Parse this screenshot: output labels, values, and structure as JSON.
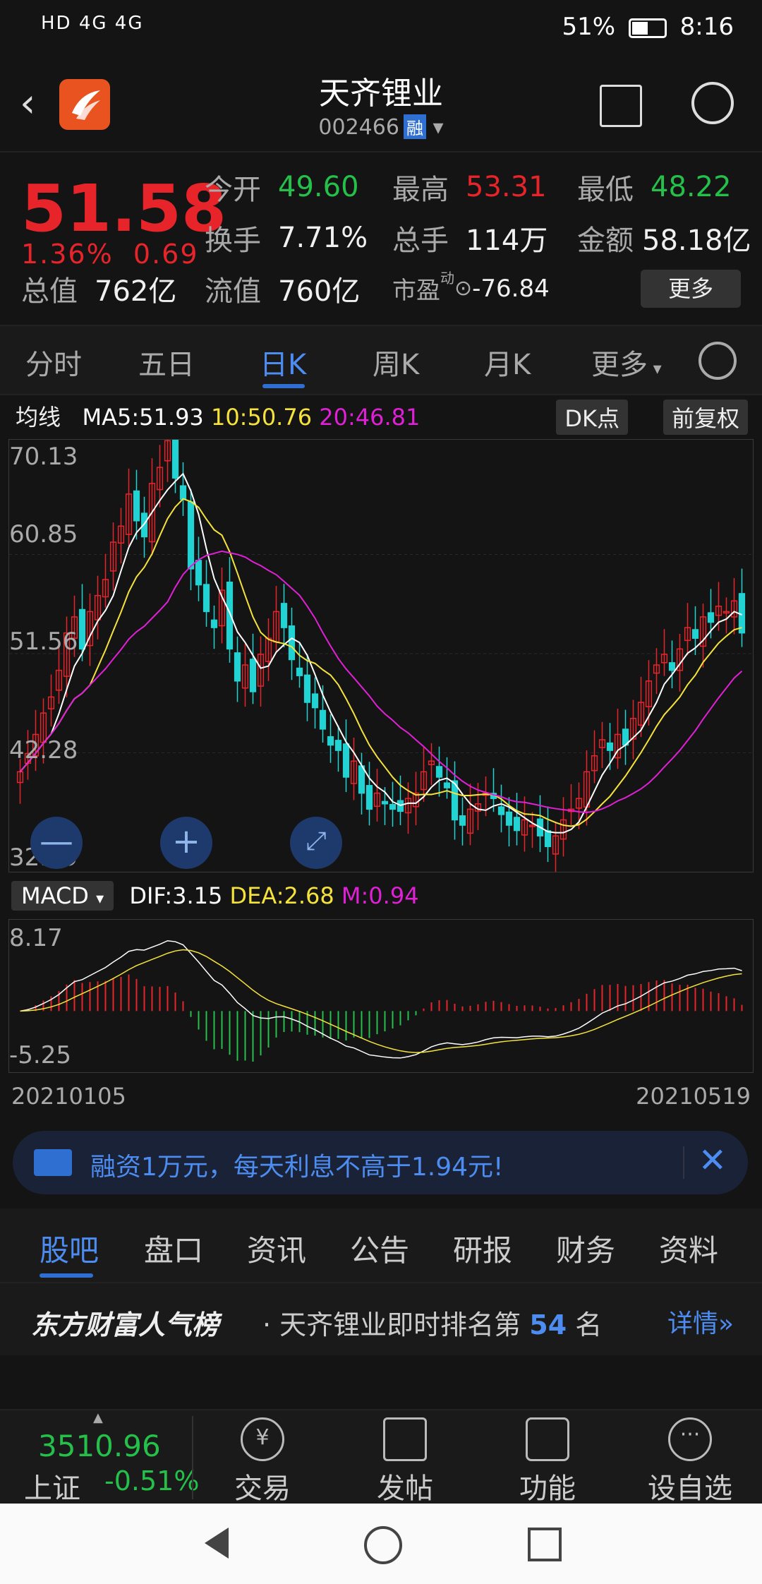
{
  "status": {
    "carrier": "HD 4G 4G",
    "battery_pct": "51%",
    "time": "8:16",
    "battery_level": 0.51
  },
  "header": {
    "title": "天齐锂业",
    "code": "002466",
    "rong_badge": "融"
  },
  "quote": {
    "price": "51.58",
    "change_pct": "1.36%",
    "change_abs": "0.69",
    "open_label": "今开",
    "open": "49.60",
    "high_label": "最高",
    "high": "53.31",
    "low_label": "最低",
    "low": "48.22",
    "turnover_label": "换手",
    "turnover": "7.71%",
    "volume_label": "总手",
    "volume": "114万",
    "amount_label": "金额",
    "amount": "58.18亿",
    "mktcap_label": "总值",
    "mktcap": "762亿",
    "float_label": "流值",
    "float": "760亿",
    "pe_label": "市盈",
    "pe_sup": "动",
    "pe": "-76.84",
    "more_label": "更多"
  },
  "ktabs": {
    "items": [
      "分时",
      "五日",
      "日K",
      "周K",
      "月K",
      "更多"
    ],
    "active": "日K"
  },
  "ma": {
    "label": "均线",
    "ma5": "MA5:51.93",
    "ma10": "10:50.76",
    "ma20": "20:46.81",
    "dk_button": "DK点",
    "fq_button": "前复权"
  },
  "macd": {
    "selector": "MACD",
    "dif": "DIF:3.15",
    "dea": "DEA:2.68",
    "m": "M:0.94"
  },
  "kchart_yaxis": [
    "70.13",
    "60.85",
    "51.56",
    "42.28",
    "32.99"
  ],
  "macd_yaxis": [
    "8.17",
    "-5.25"
  ],
  "dates": {
    "start": "20210105",
    "end": "20210519"
  },
  "chart_controls": {
    "zoom_out": "—",
    "zoom_in": "+"
  },
  "banner": {
    "text": "融资1万元，每天利息不高于1.94元!"
  },
  "sections": {
    "items": [
      "股吧",
      "盘口",
      "资讯",
      "公告",
      "研报",
      "财务",
      "资料"
    ],
    "active": "股吧"
  },
  "rank": {
    "brand": "东方财富人气榜",
    "prefix": "· 天齐锂业即时排名第",
    "number": "54",
    "suffix": "名",
    "more": "详情"
  },
  "toolbar": {
    "index_value": "3510.96",
    "index_name": "上证",
    "index_change": "-0.51%",
    "tools": [
      "交易",
      "发帖",
      "功能",
      "设自选"
    ]
  },
  "colors": {
    "up": "#e8242b",
    "down": "#25c04a",
    "accent": "#2f6fd2",
    "ma5": "#ffffff",
    "ma10": "#f5e33b",
    "ma20": "#e020d6"
  },
  "chart_data": {
    "type": "candlestick",
    "x_range": [
      "20210105",
      "20210519"
    ],
    "ylim": [
      32.99,
      70.13
    ],
    "closes": [
      40.5,
      42.2,
      44.0,
      46.0,
      47.5,
      50.0,
      53.5,
      55.0,
      52.0,
      55.5,
      57.0,
      58.5,
      62.0,
      63.5,
      66.5,
      64.0,
      62.5,
      67.5,
      69.0,
      71.5,
      68.0,
      66.0,
      59.5,
      58.0,
      55.5,
      54.0,
      57.5,
      52.0,
      49.0,
      50.5,
      48.0,
      51.5,
      53.0,
      55.5,
      54.0,
      51.0,
      49.5,
      47.0,
      46.5,
      44.5,
      43.0,
      42.5,
      40.0,
      41.5,
      38.5,
      37.0,
      38.5,
      37.5,
      37.0,
      36.8,
      38.0,
      38.5,
      40.5,
      41.5,
      40.0,
      39.0,
      36.0,
      35.5,
      37.0,
      37.5,
      38.5,
      38.0,
      36.5,
      35.5,
      35.0,
      36.0,
      35.5,
      34.5,
      33.5,
      34.5,
      36.0,
      37.0,
      38.0,
      40.5,
      42.0,
      43.5,
      42.5,
      44.0,
      43.0,
      45.5,
      47.0,
      49.0,
      50.5,
      51.5,
      50.0,
      52.0,
      54.0,
      53.0,
      55.0,
      54.5,
      56.0,
      55.5,
      56.5,
      53.5
    ],
    "ma5_last": 51.93,
    "ma10_last": 50.76,
    "ma20_last": 46.81,
    "macd": {
      "dif_last": 3.15,
      "dea_last": 2.68,
      "m_last": 0.94,
      "ylim": [
        -5.25,
        8.17
      ]
    }
  }
}
